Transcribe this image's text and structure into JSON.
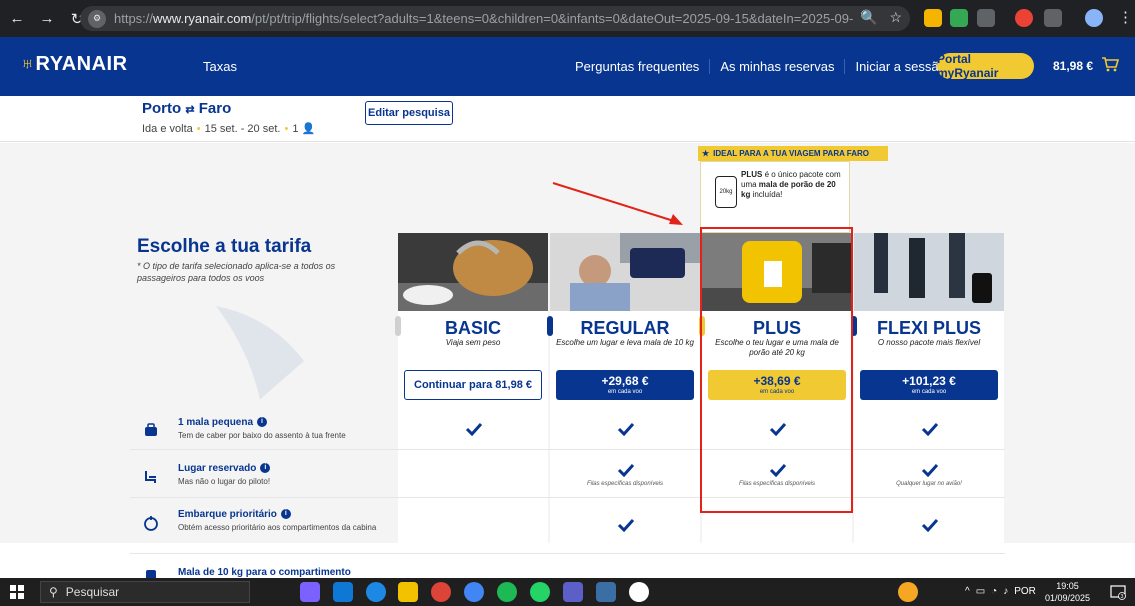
{
  "browser": {
    "url_prefix": "https://",
    "url_domain": "www.ryanair.com",
    "url_rest": "/pt/pt/trip/flights/select?adults=1&teens=0&children=0&infants=0&dateOut=2025-09-15&dateIn=2025-09-2..."
  },
  "header": {
    "logo": "RYANAIR",
    "taxas": "Taxas",
    "links": [
      "Perguntas frequentes",
      "As minhas reservas",
      "Iniciar a sessão"
    ],
    "portal": "Portal myRyanair",
    "price": "81,98 €"
  },
  "trip": {
    "origin": "Porto",
    "destination": "Faro",
    "type": "Ida e volta",
    "dates": "15 set. - 20 set.",
    "passengers": "1",
    "edit": "Editar pesquisa"
  },
  "fares": {
    "heading": "Escolhe a tua tarifa",
    "subheading": "* O tipo de tarifa selecionado aplica-se a todos os passageiros para todos os voos",
    "ideal_banner": "IDEAL PARA A TUA VIAGEM PARA FARO",
    "plus_info_1": "PLUS",
    "plus_info_2": "é o único pacote com uma",
    "plus_info_3": "mala de porão de 20 kg",
    "plus_info_4": "incluída!",
    "bag_label": "20kg",
    "columns": [
      {
        "name": "BASIC",
        "desc": "Viaja sem peso",
        "button": "Continuar para 81,98 €"
      },
      {
        "name": "REGULAR",
        "desc": "Escolhe um lugar e leva mala de 10 kg",
        "price": "+29,68 €",
        "per": "em cada voo"
      },
      {
        "name": "PLUS",
        "desc": "Escolhe o teu lugar e uma mala de porão até 20 kg",
        "price": "+38,69 €",
        "per": "em cada voo"
      },
      {
        "name": "FLEXI PLUS",
        "desc": "O nosso pacote mais flexível",
        "price": "+101,23 €",
        "per": "em cada voo"
      }
    ]
  },
  "features": [
    {
      "title": "1 mala pequena",
      "desc": "Tem de caber por baixo do assento à tua frente"
    },
    {
      "title": "Lugar reservado",
      "desc": "Mas não o lugar do piloto!"
    },
    {
      "title": "Embarque prioritário",
      "desc": "Obtém acesso prioritário aos compartimentos da cabina"
    },
    {
      "title": "Mala de 10 kg para o compartimento",
      "desc": ""
    }
  ],
  "notes": {
    "regular_seat": "Filas específicas disponíveis",
    "plus_seat": "Filas específicas disponíveis",
    "flexi_seat": "Qualquer lugar no avião!"
  },
  "taskbar": {
    "search": "Pesquisar",
    "lang": "POR",
    "time": "19:05",
    "date": "01/09/2025",
    "notif_count": "3"
  },
  "colors": {
    "brand": "#073590",
    "accent": "#f1c933",
    "highlight": "#e2231a"
  }
}
